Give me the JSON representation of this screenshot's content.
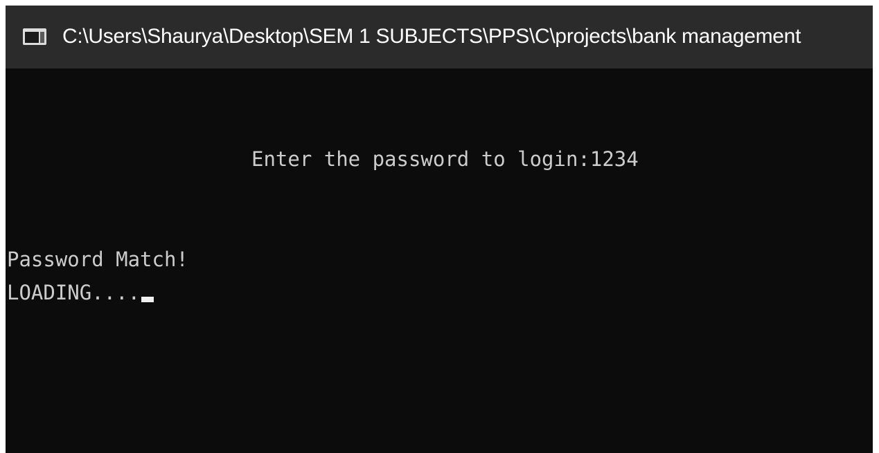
{
  "window": {
    "title": "C:\\Users\\Shaurya\\Desktop\\SEM 1 SUBJECTS\\PPS\\C\\projects\\bank management",
    "icon": "console-window-icon"
  },
  "console": {
    "prompt_label": "Enter the password to login:",
    "password_input": "1234",
    "status_message": "Password Match!",
    "loading_text": "LOADING...."
  },
  "colors": {
    "titlebar_bg": "#2b2b2b",
    "console_bg": "#0c0c0c",
    "console_text": "#cccccc",
    "title_text": "#ffffff"
  }
}
